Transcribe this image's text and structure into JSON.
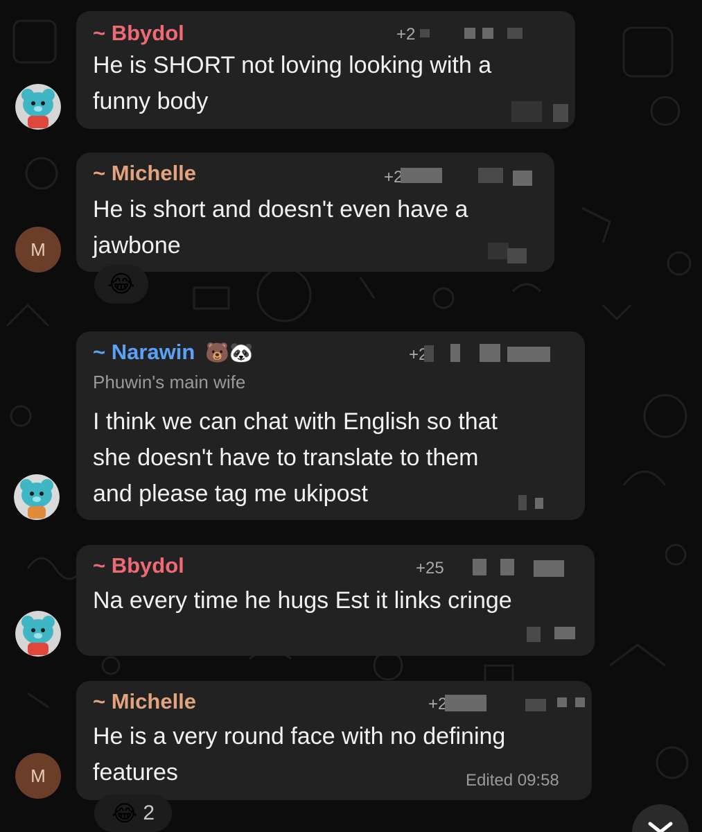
{
  "messages": [
    {
      "sender": "~ Bbydol",
      "sender_color": "#f06a76",
      "phone": "+2",
      "text": "He is SHORT not loving looking with a\nfunny body",
      "avatar_type": "bear-sticker"
    },
    {
      "sender": "~ Michelle",
      "sender_color": "#e3a37c",
      "phone": "+2",
      "text": "He is short and doesn't even have a\njawbone",
      "avatar_letter": "M",
      "reaction": {
        "emoji": "😂",
        "icon": "tears-of-joy-emoji"
      }
    },
    {
      "sender": "~ Narawin",
      "sender_emojis": "🐻🐼",
      "sender_color": "#5aa2f5",
      "phone": "+2",
      "subtitle": "Phuwin's main wife",
      "text": "I think we can chat with English so that\nshe doesn't have to translate to them\nand please tag me ukipost",
      "avatar_type": "bear-sticker-grey"
    },
    {
      "sender": "~ Bbydol",
      "sender_color": "#f06a76",
      "phone": "+25",
      "text": "Na every time he hugs Est it links cringe",
      "avatar_type": "bear-sticker"
    },
    {
      "sender": "~ Michelle",
      "sender_color": "#e3a37c",
      "phone": "+2",
      "text": "He is a very round face with no defining\nfeatures",
      "edited_label": "Edited 09:58",
      "avatar_letter": "M",
      "reaction": {
        "emoji": "😂",
        "icon": "tears-of-joy-emoji",
        "count": "2"
      }
    }
  ],
  "scroll_button": {
    "icon": "close-x-icon"
  }
}
